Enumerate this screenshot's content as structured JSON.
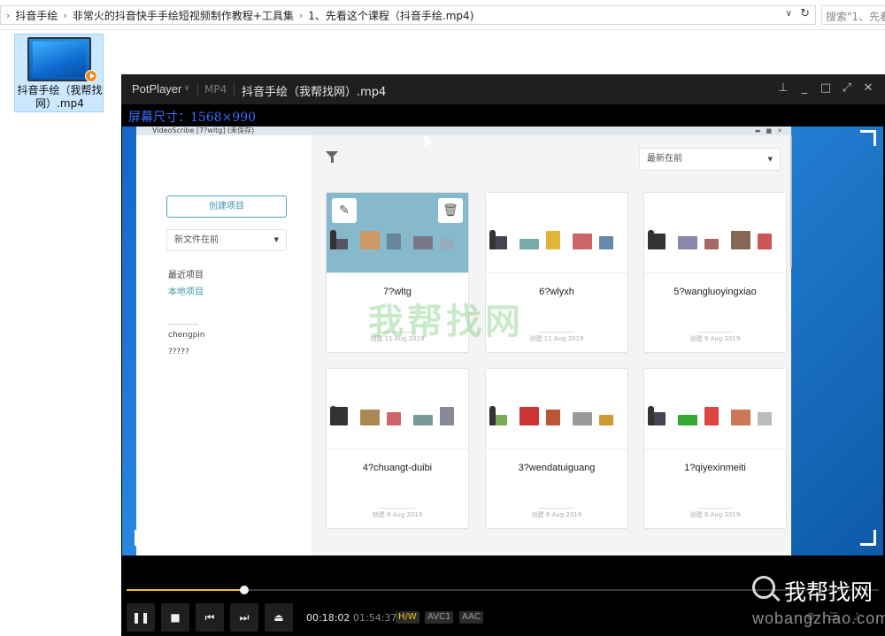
{
  "explorer": {
    "breadcrumbs": [
      "抖音手绘",
      "非常火的抖音快手手绘短视频制作教程+工具集",
      "1、先看这个课程（抖音手绘.mp4)"
    ],
    "search_placeholder": "搜索\"1、先看",
    "file": {
      "name": "抖音手绘（我帮找网）.mp4"
    }
  },
  "player": {
    "app_name": "PotPlayer",
    "format": "MP4",
    "file_title": "抖音手绘（我帮找网）.mp4",
    "osd": "屏幕尺寸：1568×990",
    "time_current": "00:18:02",
    "time_separator": "/",
    "time_total": "01:54:37",
    "progress": 0.157,
    "tags": [
      "H/W",
      "AVC1",
      "AAC"
    ],
    "buttons": [
      "play-pause",
      "stop",
      "previous",
      "next",
      "open"
    ],
    "colors": {
      "progress": "#f0c419",
      "osd": "#3b6cff",
      "hw": "#f0c419"
    }
  },
  "videoscribe": {
    "window_title": "VideoScribe [7?wltg] (未保存)",
    "create_button": "创建项目",
    "sort_select": "新文件在前",
    "recent_label": "最近项目",
    "local_label": "本地项目",
    "user": "chengpin",
    "user_sub": "?????",
    "sort_top": "最新在前",
    "cards": [
      {
        "title": "7?wltg",
        "date": "创建 11 Aug 2019",
        "selected": true
      },
      {
        "title": "6?wlyxh",
        "date": "创建 11 Aug 2019",
        "selected": false
      },
      {
        "title": "5?wangluoyingxiao",
        "date": "创建 9 Aug 2019",
        "selected": false
      },
      {
        "title": "4?chuangt-duibi",
        "date": "创建 9 Aug 2019",
        "selected": false
      },
      {
        "title": "3?wendatuiguang",
        "date": "创建 6 Aug 2019",
        "selected": false
      },
      {
        "title": "1?qiyexinmeiti",
        "date": "创建 6 Aug 2019",
        "selected": false
      }
    ],
    "watermark": "我帮找网"
  },
  "site_watermark": {
    "name": "我帮找网",
    "url": "wobangzhao.com"
  }
}
